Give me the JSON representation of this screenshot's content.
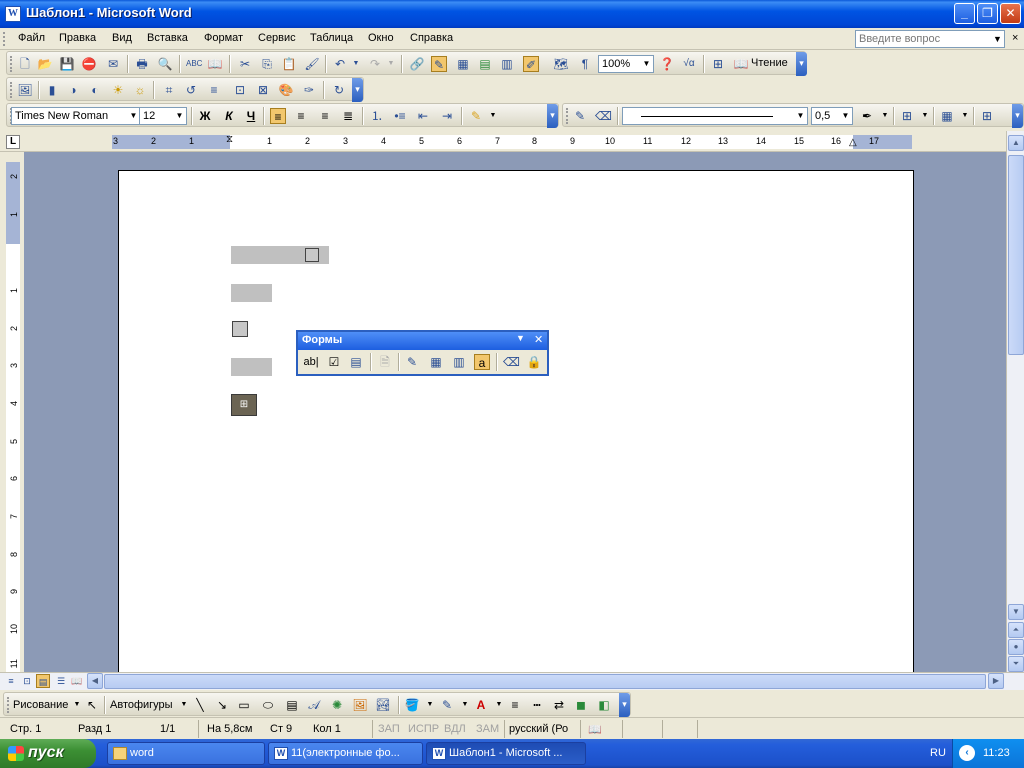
{
  "window": {
    "title": "Шаблон1 - Microsoft Word",
    "app_icon": "W"
  },
  "menu": [
    "Файл",
    "Правка",
    "Вид",
    "Вставка",
    "Формат",
    "Сервис",
    "Таблица",
    "Окно",
    "Справка"
  ],
  "help_placeholder": "Введите вопрос",
  "standard_toolbar": {
    "zoom": "100%",
    "reading_label": "Чтение"
  },
  "formatting_toolbar": {
    "font_name": "Times New Roman",
    "font_size": "12",
    "bold": "Ж",
    "italic": "К",
    "underline": "Ч",
    "line_weight": "0,5"
  },
  "ruler_numbers": [
    "3",
    "2",
    "1",
    "1",
    "2",
    "3",
    "4",
    "5",
    "6",
    "7",
    "8",
    "9",
    "10",
    "11",
    "12",
    "13",
    "14",
    "15",
    "16",
    "17"
  ],
  "vruler_numbers": [
    "2",
    "1",
    "1",
    "2",
    "3",
    "4",
    "5",
    "6",
    "7",
    "8",
    "9",
    "10",
    "11"
  ],
  "forms_toolbar": {
    "title": "Формы",
    "textfield_label": "ab|"
  },
  "drawing_toolbar": {
    "draw_label": "Рисование",
    "autoshapes_label": "Автофигуры"
  },
  "status": {
    "page": "Стр. 1",
    "section": "Разд 1",
    "pages": "1/1",
    "at": "На 5,8см",
    "line": "Ст 9",
    "col": "Кол 1",
    "rec": "ЗАП",
    "trk": "ИСПР",
    "ext": "ВДЛ",
    "ovr": "ЗАМ",
    "language": "русский (Ро"
  },
  "taskbar": {
    "start": "пуск",
    "tasks": [
      "word",
      "11(электронные фо...",
      "Шаблон1 - Microsoft ..."
    ],
    "lang": "RU",
    "time": "11:23"
  },
  "colors": {
    "titlebar": "#0054e3",
    "page_bg": "#8c9ab6",
    "field_gray": "#c0c0c0"
  }
}
